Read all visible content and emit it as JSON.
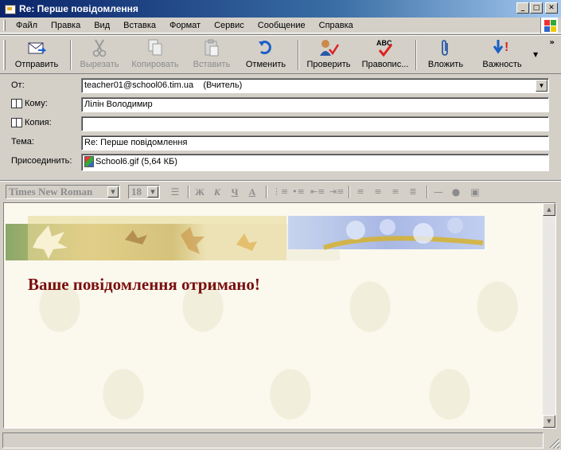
{
  "window": {
    "title": "Re: Перше повідомлення"
  },
  "menu": {
    "items": [
      "Файл",
      "Правка",
      "Вид",
      "Вставка",
      "Формат",
      "Сервис",
      "Сообщение",
      "Справка"
    ]
  },
  "toolbar": {
    "send": "Отправить",
    "cut": "Вырезать",
    "copy": "Копировать",
    "paste": "Вставить",
    "undo": "Отменить",
    "check": "Проверить",
    "spelling": "Правопис...",
    "attach": "Вложить",
    "priority": "Важность",
    "spelling_icon_text": "ABC",
    "priority_icon_text": "!",
    "more": "»"
  },
  "header": {
    "from_label": "От:",
    "from_value": "teacher01@school06.tim.ua    (Вчитель)",
    "to_label": "Кому:",
    "to_value": "Лілін Володимир",
    "cc_label": "Копия:",
    "cc_value": "",
    "subject_label": "Тема:",
    "subject_value": "Re: Перше повідомлення",
    "attach_label": "Присоединить:",
    "attach_value": "School6.gif (5,64 КБ)"
  },
  "format": {
    "font": "Times New Roman",
    "size": "18",
    "bold": "Ж",
    "italic": "К",
    "underline": "Ч",
    "font_color": "А"
  },
  "message": {
    "heading": "Ваше повідомлення отримано!"
  },
  "colors": {
    "heading": "#7a0f0f",
    "titlebar_start": "#0a246a",
    "titlebar_end": "#a6caf0"
  }
}
